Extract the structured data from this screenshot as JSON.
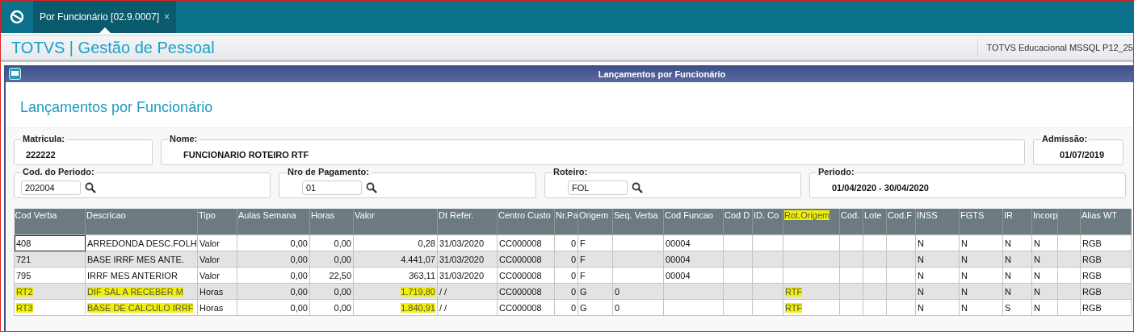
{
  "tab": {
    "label": "Por Funcionário [02.9.0007]",
    "close": "×",
    "selected": true
  },
  "app_title": "TOTVS | Gestão de Pessoal",
  "environment": "TOTVS Educacional MSSQL P12_25",
  "panel": {
    "title": "Lançamentos por Funcionário",
    "heading": "Lançamentos por Funcionário"
  },
  "fields": [
    [
      {
        "label": "Matricula:",
        "value": "222222",
        "kind": "text"
      },
      {
        "label": "Nome:",
        "value": "FUNCIONARIO ROTEIRO RTF",
        "kind": "text"
      },
      {
        "label": "Admissão:",
        "value": "01/07/2019",
        "kind": "text"
      }
    ],
    [
      {
        "label": "Cod. do Periodo:",
        "value": "202004",
        "kind": "lookup"
      },
      {
        "label": "Nro de Pagamento:",
        "value": "01",
        "kind": "lookup"
      },
      {
        "label": "Roteiro:",
        "value": "FOL",
        "kind": "lookup"
      },
      {
        "label": "Periodo:",
        "value": "01/04/2020 - 30/04/2020",
        "kind": "text"
      }
    ]
  ],
  "table": {
    "columns": [
      {
        "label": "Cod Verba",
        "highlighted": false
      },
      {
        "label": "Descricao",
        "highlighted": false
      },
      {
        "label": "Tipo",
        "highlighted": false
      },
      {
        "label": "Aulas Semana",
        "highlighted": false
      },
      {
        "label": "Horas",
        "highlighted": false
      },
      {
        "label": "Valor",
        "highlighted": false
      },
      {
        "label": "Dt Refer.",
        "highlighted": false
      },
      {
        "label": "Centro Custo",
        "highlighted": false
      },
      {
        "label": "Nr.Pa",
        "highlighted": false
      },
      {
        "label": "Origem",
        "highlighted": false
      },
      {
        "label": "Seq. Verba",
        "highlighted": false
      },
      {
        "label": "Cod Funcao",
        "highlighted": false
      },
      {
        "label": "Cod D",
        "highlighted": false
      },
      {
        "label": "ID. Co",
        "highlighted": false
      },
      {
        "label": "Rot.Origem",
        "highlighted": true
      },
      {
        "label": "Cod.",
        "highlighted": false
      },
      {
        "label": "Lote",
        "highlighted": false
      },
      {
        "label": "Cod.F",
        "highlighted": false
      },
      {
        "label": "INSS",
        "highlighted": false
      },
      {
        "label": "FGTS",
        "highlighted": false
      },
      {
        "label": "IR",
        "highlighted": false
      },
      {
        "label": "Incorp",
        "highlighted": false
      },
      null,
      {
        "label": "Alias WT",
        "highlighted": false
      }
    ],
    "rows": [
      {
        "selected": true,
        "cells": [
          {
            "text": "408",
            "highlighted": false
          },
          {
            "text": "ARREDONDA DESC.FOLH",
            "highlighted": false
          },
          {
            "text": "Valor",
            "highlighted": false
          },
          {
            "text": "0,00",
            "highlighted": false
          },
          {
            "text": "0,00",
            "highlighted": false
          },
          {
            "text": "0,28",
            "highlighted": false
          },
          {
            "text": "31/03/2020",
            "highlighted": false
          },
          {
            "text": "CC000008",
            "highlighted": false
          },
          {
            "text": "0",
            "highlighted": false
          },
          {
            "text": "F",
            "highlighted": false
          },
          null,
          {
            "text": "00004",
            "highlighted": false
          },
          null,
          null,
          null,
          null,
          null,
          null,
          {
            "text": "N",
            "highlighted": false
          },
          {
            "text": "N",
            "highlighted": false
          },
          {
            "text": "N",
            "highlighted": false
          },
          {
            "text": "N",
            "highlighted": false
          },
          null,
          {
            "text": "RGB",
            "highlighted": false
          }
        ]
      },
      {
        "selected": false,
        "cells": [
          {
            "text": "721",
            "highlighted": false
          },
          {
            "text": "BASE IRRF MES ANTE.",
            "highlighted": false
          },
          {
            "text": "Valor",
            "highlighted": false
          },
          {
            "text": "0,00",
            "highlighted": false
          },
          {
            "text": "0,00",
            "highlighted": false
          },
          {
            "text": "4.441,07",
            "highlighted": false
          },
          {
            "text": "31/03/2020",
            "highlighted": false
          },
          {
            "text": "CC000008",
            "highlighted": false
          },
          {
            "text": "0",
            "highlighted": false
          },
          {
            "text": "F",
            "highlighted": false
          },
          null,
          {
            "text": "00004",
            "highlighted": false
          },
          null,
          null,
          null,
          null,
          null,
          null,
          {
            "text": "N",
            "highlighted": false
          },
          {
            "text": "N",
            "highlighted": false
          },
          {
            "text": "N",
            "highlighted": false
          },
          {
            "text": "N",
            "highlighted": false
          },
          null,
          {
            "text": "RGB",
            "highlighted": false
          }
        ]
      },
      {
        "selected": false,
        "cells": [
          {
            "text": "795",
            "highlighted": false
          },
          {
            "text": "IRRF MES ANTERIOR",
            "highlighted": false
          },
          {
            "text": "Valor",
            "highlighted": false
          },
          {
            "text": "0,00",
            "highlighted": false
          },
          {
            "text": "22,50",
            "highlighted": false
          },
          {
            "text": "363,11",
            "highlighted": false
          },
          {
            "text": "31/03/2020",
            "highlighted": false
          },
          {
            "text": "CC000008",
            "highlighted": false
          },
          {
            "text": "0",
            "highlighted": false
          },
          {
            "text": "F",
            "highlighted": false
          },
          null,
          {
            "text": "00004",
            "highlighted": false
          },
          null,
          null,
          null,
          null,
          null,
          null,
          {
            "text": "N",
            "highlighted": false
          },
          {
            "text": "N",
            "highlighted": false
          },
          {
            "text": "N",
            "highlighted": false
          },
          {
            "text": "N",
            "highlighted": false
          },
          null,
          {
            "text": "RGB",
            "highlighted": false
          }
        ]
      },
      {
        "selected": false,
        "cells": [
          {
            "text": "RT2",
            "highlighted": true
          },
          {
            "text": "DIF SAL A RECEBER M",
            "highlighted": true
          },
          {
            "text": "Horas",
            "highlighted": false
          },
          {
            "text": "0,00",
            "highlighted": false
          },
          {
            "text": "0,00",
            "highlighted": false
          },
          {
            "text": "1.719,80",
            "highlighted": true
          },
          {
            "text": "/  /",
            "highlighted": false
          },
          {
            "text": "CC000008",
            "highlighted": false
          },
          {
            "text": "0",
            "highlighted": false
          },
          {
            "text": "G",
            "highlighted": false
          },
          {
            "text": "0",
            "highlighted": false
          },
          null,
          null,
          null,
          {
            "text": "RTF",
            "highlighted": true
          },
          null,
          null,
          null,
          {
            "text": "N",
            "highlighted": false
          },
          {
            "text": "N",
            "highlighted": false
          },
          {
            "text": "N",
            "highlighted": false
          },
          {
            "text": "N",
            "highlighted": false
          },
          null,
          {
            "text": "RGB",
            "highlighted": false
          }
        ]
      },
      {
        "selected": false,
        "cells": [
          {
            "text": "RT3",
            "highlighted": true
          },
          {
            "text": "BASE DE CALCULO IRRF",
            "highlighted": true
          },
          {
            "text": "Horas",
            "highlighted": false
          },
          {
            "text": "0,00",
            "highlighted": false
          },
          {
            "text": "0,00",
            "highlighted": false
          },
          {
            "text": "1.840,91",
            "highlighted": true
          },
          {
            "text": "/  /",
            "highlighted": false
          },
          {
            "text": "CC000008",
            "highlighted": false
          },
          {
            "text": "0",
            "highlighted": false
          },
          {
            "text": "G",
            "highlighted": false
          },
          {
            "text": "0",
            "highlighted": false
          },
          null,
          null,
          null,
          {
            "text": "RTF",
            "highlighted": true
          },
          null,
          null,
          null,
          {
            "text": "N",
            "highlighted": false
          },
          {
            "text": "N",
            "highlighted": false
          },
          {
            "text": "S",
            "highlighted": false
          },
          {
            "text": "N",
            "highlighted": false
          },
          null,
          {
            "text": "RGB",
            "highlighted": false
          }
        ]
      }
    ]
  }
}
